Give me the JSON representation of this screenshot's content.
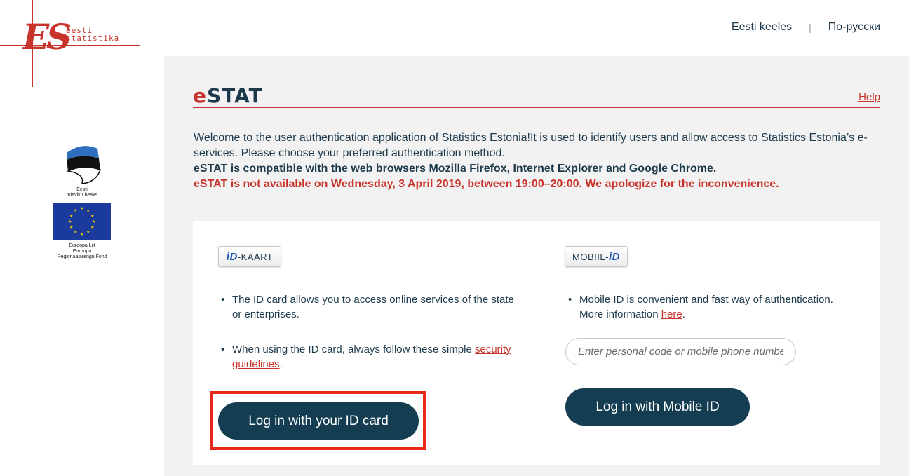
{
  "brand": {
    "logo_mark": "ES",
    "logo_line1": "eesti",
    "logo_line2": "statistika"
  },
  "sponsor": {
    "flag_caption_1": "Eesti",
    "flag_caption_2": "tuleviku heaks",
    "eu_caption_1": "Euroopa Liit",
    "eu_caption_2": "Euroopa",
    "eu_caption_3": "Regionaalarengu Fond"
  },
  "header": {
    "lang_et": "Eesti keeles",
    "separator": "|",
    "lang_ru": "По-русски"
  },
  "app": {
    "logo_e": "e",
    "logo_stat": "STAT",
    "help_label": "Help"
  },
  "intro": {
    "welcome": "Welcome to the user authentication application of Statistics Estonia!It is used to identify users and allow access to Statistics Estonia’s e-services. Please choose your preferred authentication method.",
    "compat": "eSTAT is compatible with the web browsers Mozilla Firefox, Internet Explorer and Google Chrome.",
    "notice": "eSTAT is not available on Wednesday, 3 April 2019, between 19:00–20:00. We apologize for the inconvenience."
  },
  "id_card": {
    "badge_id": "iD",
    "badge_text": "-KAART",
    "bullet1": "The ID card allows you to access online services of the state or enterprises.",
    "bullet2_prefix": "When using the ID card, always follow these simple ",
    "bullet2_link": "security guidelines",
    "bullet2_suffix": ".",
    "button_label": "Log in with your ID card"
  },
  "mobile_id": {
    "badge_text": "MOBIIL-",
    "badge_id": "iD",
    "bullet1_prefix": "Mobile ID is convenient and fast way of authentication. More information ",
    "bullet1_link": "here",
    "bullet1_suffix": ".",
    "input_placeholder": "Enter personal code or mobile phone number",
    "button_label": "Log in with Mobile ID"
  },
  "colors": {
    "brand_red": "#c8342b",
    "navy": "#143d52",
    "highlight": "#e8281c"
  }
}
